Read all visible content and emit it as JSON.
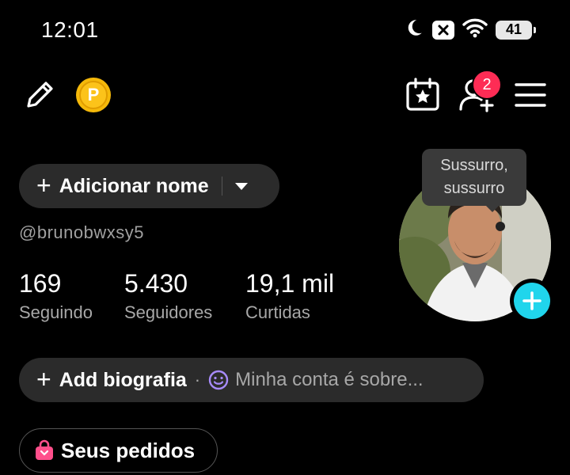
{
  "status_bar": {
    "time": "12:01",
    "battery": "41",
    "icons": [
      "moon-icon",
      "x-notification-icon",
      "wifi-icon",
      "battery-icon"
    ]
  },
  "header": {
    "icons": [
      "pencil-icon",
      "coin-icon",
      "calendar-star-icon",
      "add-user-icon",
      "hamburger-menu-icon"
    ],
    "coin_letter": "P",
    "notification_count": "2"
  },
  "profile": {
    "add_name_label": "Adicionar nome",
    "username": "@brunobwxsy5",
    "tooltip": "Sussurro, sussurro",
    "stats": [
      {
        "value": "169",
        "label": "Seguindo"
      },
      {
        "value": "5.430",
        "label": "Seguidores"
      },
      {
        "value": "19,1 mil",
        "label": "Curtidas"
      }
    ],
    "bio_label": "Add biografia",
    "bio_separator": "·",
    "bio_placeholder": "Minha conta é sobre...",
    "orders_label": "Seus pedidos"
  },
  "colors": {
    "background": "#000000",
    "pill": "#2b2b2b",
    "badge": "#fe2c55",
    "accent_plus": "#20d5ec",
    "coin": "#f5b90a",
    "secondary_text": "#a8a8a8"
  }
}
